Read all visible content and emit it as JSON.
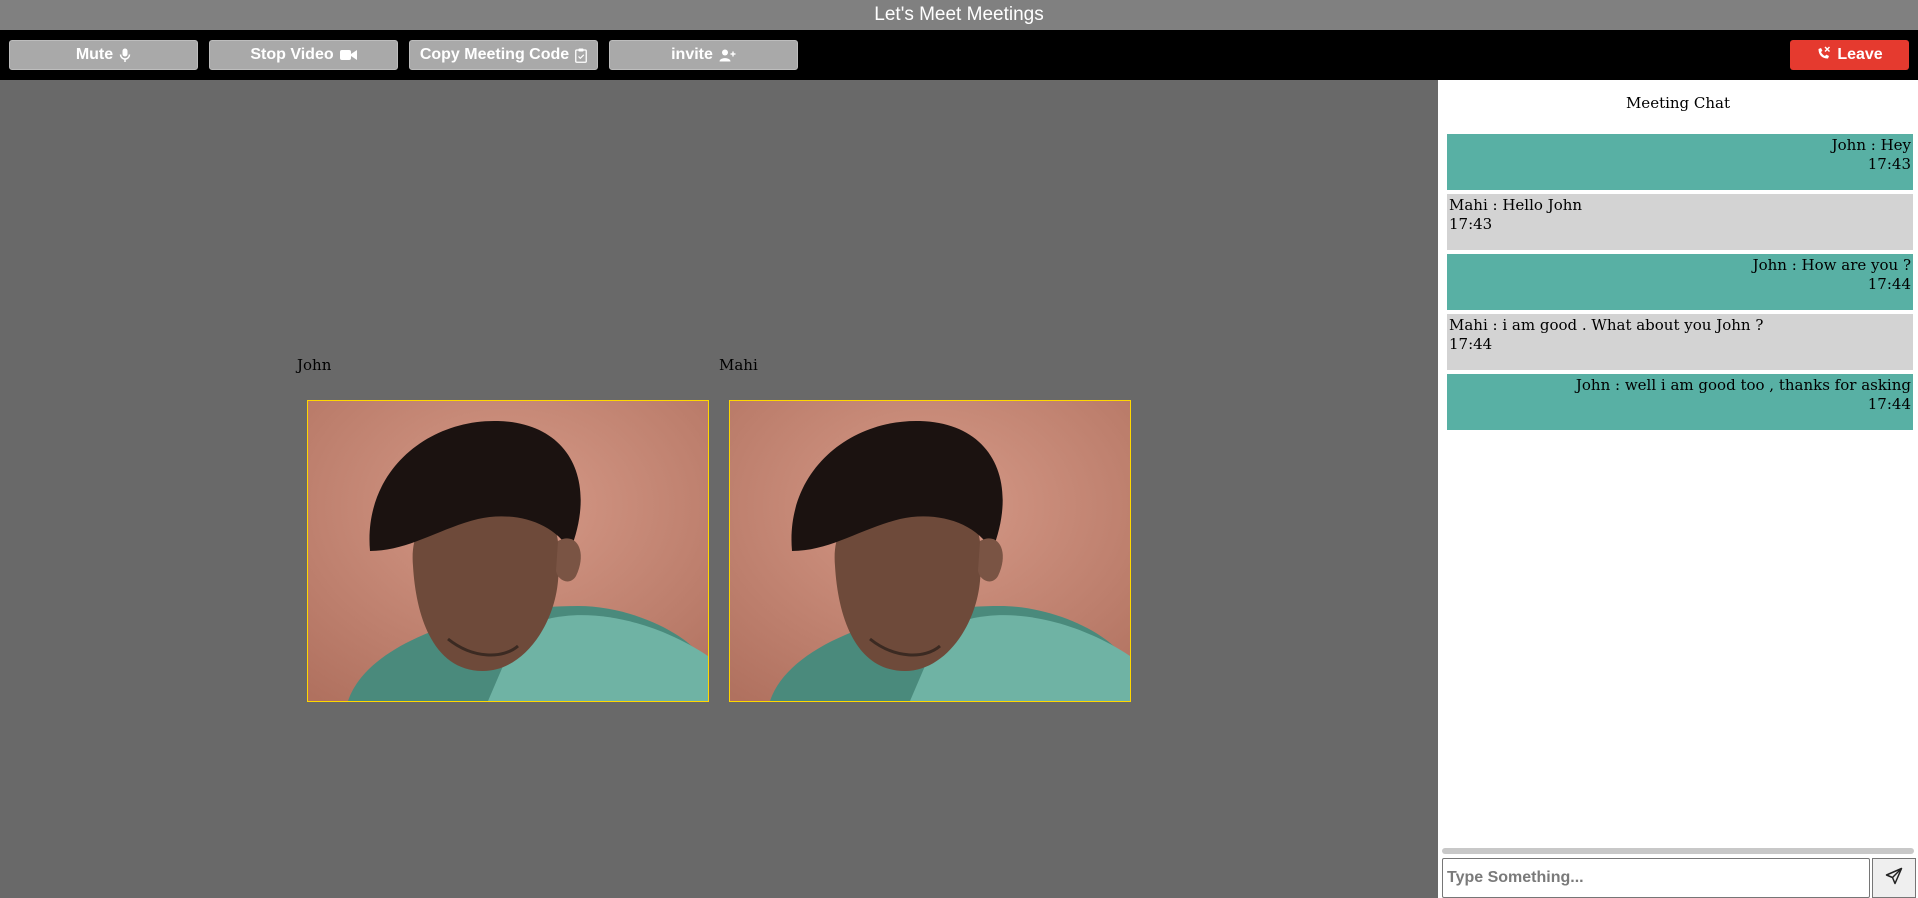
{
  "app": {
    "title": "Let's Meet Meetings"
  },
  "toolbar": {
    "mute": {
      "label": "Mute",
      "icon": "microphone-icon"
    },
    "stop_video": {
      "label": "Stop Video",
      "icon": "video-camera-icon"
    },
    "copy_code": {
      "label": "Copy Meeting Code",
      "icon": "clipboard-icon"
    },
    "invite": {
      "label": "invite",
      "icon": "add-user-icon"
    },
    "leave": {
      "label": "Leave",
      "icon": "phone-hangup-icon"
    }
  },
  "participants": [
    {
      "name": "John"
    },
    {
      "name": "Mahi"
    }
  ],
  "chat": {
    "title": "Meeting Chat",
    "messages": [
      {
        "text": "John : Hey",
        "time": "17:43",
        "mine": true
      },
      {
        "text": "Mahi : Hello John",
        "time": "17:43",
        "mine": false
      },
      {
        "text": "John : How are you ?",
        "time": "17:44",
        "mine": true
      },
      {
        "text": "Mahi : i am good . What about you John ?",
        "time": "17:44",
        "mine": false
      },
      {
        "text": "John : well i am good too , thanks for asking",
        "time": "17:44",
        "mine": true
      }
    ],
    "input": {
      "placeholder": "Type Something...",
      "value": ""
    },
    "send_icon": "send-icon"
  },
  "colors": {
    "title_bar": "#808080",
    "toolbar": "#000000",
    "button": "#a9a9a9",
    "leave": "#e53a2f",
    "video_bg": "#696969",
    "video_border": "#ffd700",
    "own_message": "#58b0a4",
    "other_message": "#d3d3d3"
  }
}
